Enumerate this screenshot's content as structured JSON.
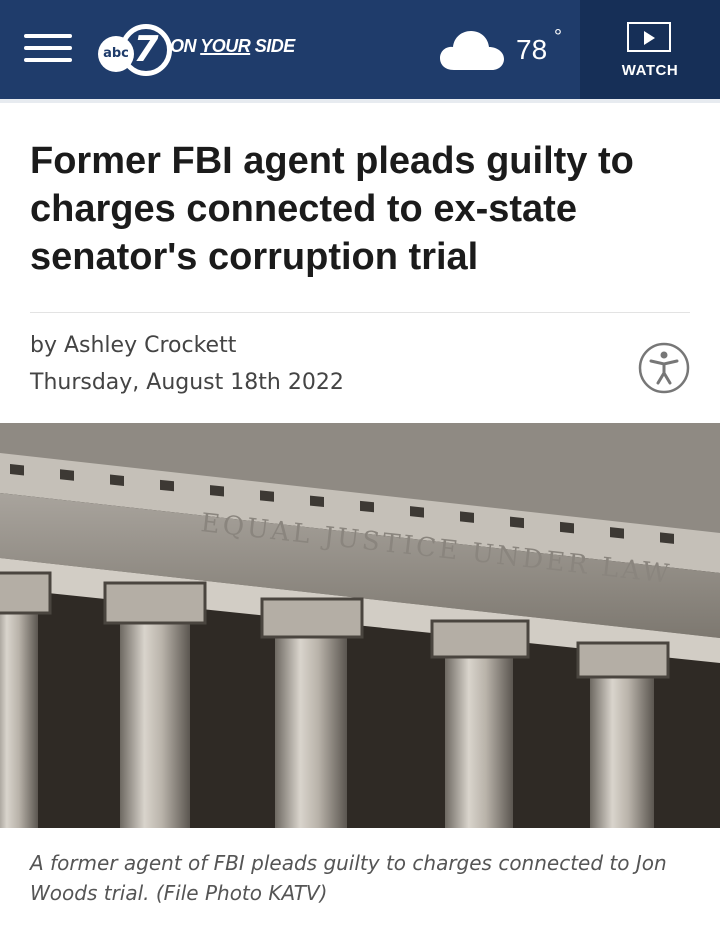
{
  "header": {
    "logo_badge": "abc",
    "logo_number": "7",
    "logo_tagline_1": "ON ",
    "logo_tagline_2": "YOUR",
    "logo_tagline_3": " SIDE",
    "temperature": "78",
    "temperature_unit": "°",
    "watch_label": "WATCH",
    "colors": {
      "bar": "#1f3c6b",
      "watch_bg": "#162f57"
    }
  },
  "article": {
    "headline": "Former FBI agent pleads guilty to charges connected to ex-state senator's corruption trial",
    "byline": "by Ashley Crockett",
    "date": "Thursday, August 18th 2022",
    "photo_inscription": "EQUAL JUSTICE UNDER LAW",
    "caption": "A former agent of FBI pleads guilty to charges connected to Jon Woods trial. (File Photo KATV)"
  },
  "icons": [
    "menu-icon",
    "cloud-icon",
    "play-icon",
    "accessibility-icon"
  ]
}
